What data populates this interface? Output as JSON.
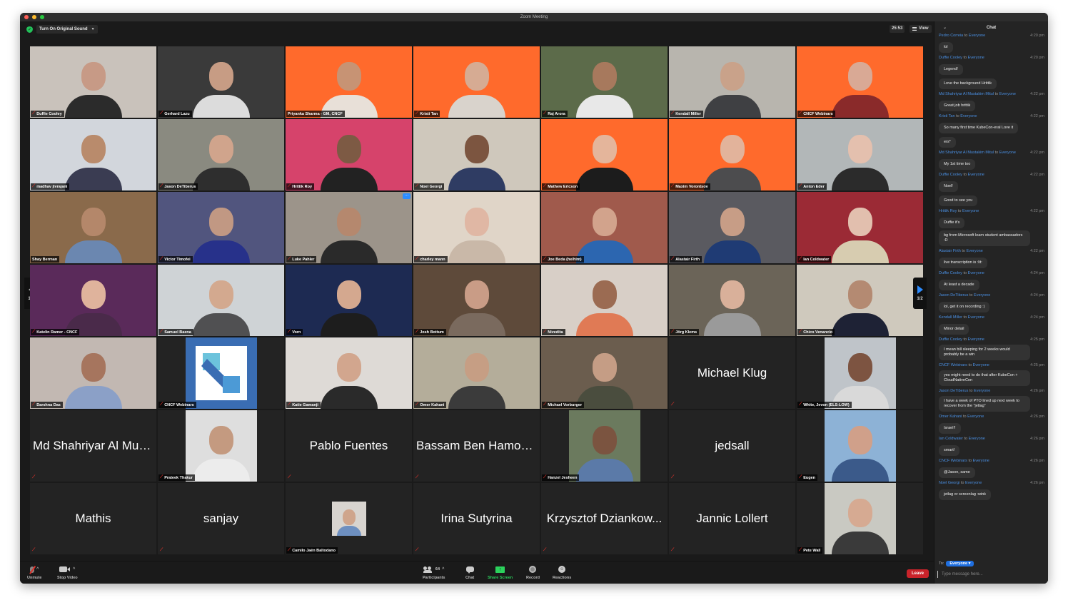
{
  "window": {
    "title": "Zoom Meeting"
  },
  "topbar": {
    "original_sound_label": "Turn On Original Sound",
    "timer": "25:53",
    "view_label": "View"
  },
  "pager": {
    "label": "1/2"
  },
  "tiles": [
    {
      "name": "Duffie Cooley",
      "type": "video",
      "bg": "#c9c2bb",
      "skin": "#c79a86",
      "shirt": "#2b2b2b",
      "muted": true
    },
    {
      "name": "Gerhard Lazu",
      "type": "video",
      "bg": "#3a3a3a",
      "skin": "#c79c84",
      "shirt": "#dcdcdc",
      "muted": true
    },
    {
      "name": "Priyanka Sharma - GM, CNCF",
      "type": "video",
      "bg": "#ff6a2c",
      "skin": "#c79374",
      "shirt": "#e8e0d8",
      "muted": false
    },
    {
      "name": "Kristi Tan",
      "type": "video",
      "bg": "#ff6a2c",
      "skin": "#d6ab93",
      "shirt": "#d9d3cc",
      "muted": true
    },
    {
      "name": "Raj Arora",
      "type": "video",
      "bg": "#5c6b4a",
      "skin": "#a7795d",
      "shirt": "#e8e8e8",
      "muted": true
    },
    {
      "name": "Kendall Miller",
      "type": "video",
      "bg": "#b8b5ae",
      "skin": "#c9a28a",
      "shirt": "#3f4043",
      "muted": true
    },
    {
      "name": "CNCF Webinars",
      "type": "video",
      "bg": "#ff6a2c",
      "skin": "#d9a995",
      "shirt": "#8a2a2a",
      "muted": true
    },
    {
      "name": "madhav jivrajani",
      "type": "video",
      "bg": "#d2d6dc",
      "skin": "#b98b6c",
      "shirt": "#3a3c52",
      "muted": true
    },
    {
      "name": "Jason DeTiberus",
      "type": "video",
      "bg": "#8a8a80",
      "skin": "#d0a48c",
      "shirt": "#2e2e2e",
      "muted": true
    },
    {
      "name": "Hrittik Roy",
      "type": "video",
      "bg": "#d6436b",
      "skin": "#7d5a44",
      "shirt": "#222222",
      "muted": true
    },
    {
      "name": "Noel Georgi",
      "type": "video",
      "bg": "#cfc8bc",
      "skin": "#7c5540",
      "shirt": "#2f3c63",
      "muted": true
    },
    {
      "name": "Mathew Ericson",
      "type": "video",
      "bg": "#ff6a2c",
      "skin": "#e4b59b",
      "shirt": "#1c1c1c",
      "muted": true
    },
    {
      "name": "Maxim Vorontsov",
      "type": "video",
      "bg": "#ff6a2c",
      "skin": "#e2b39b",
      "shirt": "#4c4c4e",
      "muted": true
    },
    {
      "name": "Anton Eder",
      "type": "video",
      "bg": "#b2b7b8",
      "skin": "#e4c0ae",
      "shirt": "#2b2b2b",
      "muted": true
    },
    {
      "name": "Shay Berman",
      "type": "video",
      "bg": "#8a6a4b",
      "skin": "#b4876a",
      "shirt": "#6b87b0",
      "muted": false,
      "active": true
    },
    {
      "name": "Victor Timofei",
      "type": "video",
      "bg": "#51557e",
      "skin": "#c19883",
      "shirt": "#27318a",
      "muted": true
    },
    {
      "name": "Luke Pahler",
      "type": "video",
      "bg": "#9c948a",
      "skin": "#b5886e",
      "shirt": "#2a2a2a",
      "muted": true,
      "more": true
    },
    {
      "name": "charley mann",
      "type": "video",
      "bg": "#e0d5c8",
      "skin": "#e0b7a4",
      "shirt": "#c9b8a8",
      "muted": true
    },
    {
      "name": "Joe Beda (he/him)",
      "type": "video",
      "bg": "#a05a4c",
      "skin": "#d2a38c",
      "shirt": "#2c66b0",
      "muted": true
    },
    {
      "name": "Alastair Firth",
      "type": "video",
      "bg": "#5a5a60",
      "skin": "#c79d86",
      "shirt": "#1f3b74",
      "muted": true
    },
    {
      "name": "Ian Coldwater",
      "type": "video",
      "bg": "#9b2a35",
      "skin": "#e2bfae",
      "shirt": "#d7ccb0",
      "muted": true
    },
    {
      "name": "Katelin Ramer - CNCF",
      "type": "video",
      "bg": "#5a2a5a",
      "skin": "#dfb39c",
      "shirt": "#4a2a4a",
      "muted": true
    },
    {
      "name": "Samuel Baena",
      "type": "video",
      "bg": "#cfd3d6",
      "skin": "#d3a98f",
      "shirt": "#505052",
      "muted": true
    },
    {
      "name": "Vorn",
      "type": "video",
      "bg": "#1d2a52",
      "skin": "#d4a88f",
      "shirt": "#1d1d1d",
      "muted": true
    },
    {
      "name": "Josh Bottum",
      "type": "video",
      "bg": "#5e4a3a",
      "skin": "#c99c86",
      "shirt": "#7a6a5e",
      "muted": true
    },
    {
      "name": "Nivedita",
      "type": "video",
      "bg": "#d8cfc7",
      "skin": "#9b6b52",
      "shirt": "#e07a55",
      "muted": true
    },
    {
      "name": "Jörg Klems",
      "type": "video",
      "bg": "#6b6458",
      "skin": "#d9b09a",
      "shirt": "#9a9a9a",
      "muted": true
    },
    {
      "name": "Chico Venancio",
      "type": "video",
      "bg": "#cfc9bd",
      "skin": "#b48a72",
      "shirt": "#1e2235",
      "muted": true
    },
    {
      "name": "Darshna Das",
      "type": "video",
      "bg": "#c2b8b2",
      "skin": "#a6755e",
      "shirt": "#8ba0c7",
      "muted": true
    },
    {
      "name": "CNCF Webinars",
      "type": "logo",
      "muted": true
    },
    {
      "name": "Katie Gamanji",
      "type": "video",
      "bg": "#dedad6",
      "skin": "#d2a68e",
      "shirt": "#2a2a2a",
      "muted": true
    },
    {
      "name": "Omer Kahani",
      "type": "video",
      "bg": "#b4ad9a",
      "skin": "#c69e84",
      "shirt": "#3b3b3b",
      "muted": true
    },
    {
      "name": "Michael Vorburger",
      "type": "video",
      "bg": "#6b5d4e",
      "skin": "#c59d85",
      "shirt": "#4a4d3e",
      "muted": true
    },
    {
      "name": "Michael Klug",
      "type": "name",
      "muted": true
    },
    {
      "name": "White, Jevon (ELS-LOW)",
      "type": "portrait",
      "bg": "#bfc4c9",
      "skin": "#7d5441",
      "shirt": "#d9d9d9",
      "muted": true
    },
    {
      "name": "Md Shahriyar Al Mus...",
      "type": "name",
      "muted": true
    },
    {
      "name": "Prateek Thakur",
      "type": "portrait",
      "bg": "#dedede",
      "skin": "#c49a80",
      "shirt": "#ececec",
      "muted": true
    },
    {
      "name": "Pablo Fuentes",
      "type": "name",
      "muted": true
    },
    {
      "name": "Bassam Ben Hamou...",
      "type": "name",
      "muted": true
    },
    {
      "name": "Hanzel Jesheen",
      "type": "portrait",
      "bg": "#6b7a5e",
      "skin": "#7b5440",
      "shirt": "#5b7aa8",
      "muted": true
    },
    {
      "name": "jedsall",
      "type": "name",
      "muted": true
    },
    {
      "name": "Eugen",
      "type": "portrait",
      "bg": "#8db2d6",
      "skin": "#d0a08a",
      "shirt": "#3b5a8a",
      "muted": true
    },
    {
      "name": "Mathis",
      "type": "name",
      "muted": true
    },
    {
      "name": "sanjay",
      "type": "name",
      "muted": true
    },
    {
      "name": "Camilo Jaén Baltodano",
      "type": "small",
      "bg": "#d8d4cf",
      "skin": "#cfa58c",
      "shirt": "#6d8fc0",
      "muted": true
    },
    {
      "name": "Irina Sutyrina",
      "type": "name",
      "muted": true
    },
    {
      "name": "Krzysztof Dziankow...",
      "type": "name",
      "muted": true
    },
    {
      "name": "Jannic Lollert",
      "type": "name",
      "muted": true
    },
    {
      "name": "Pete Wall",
      "type": "portrait",
      "bg": "#c9c9c2",
      "skin": "#d6aa92",
      "shirt": "#3a3a3a",
      "muted": true
    }
  ],
  "toolbar": {
    "unmute": "Unmute",
    "stop_video": "Stop Video",
    "participants": "Participants",
    "participant_count": "64",
    "chat": "Chat",
    "share_screen": "Share Screen",
    "record": "Record",
    "reactions": "Reactions",
    "leave": "Leave"
  },
  "chat": {
    "title": "Chat",
    "to_label": "To:",
    "to_value": "Everyone",
    "placeholder": "Type message here...",
    "to_word": "to",
    "messages": [
      {
        "from": "Pedro Correia",
        "to": "Everyone",
        "time": "4:20 pm",
        "texts": [
          "lol"
        ]
      },
      {
        "from": "Duffie Cooley",
        "to": "Everyone",
        "time": "4:20 pm",
        "texts": [
          "Legend!",
          "Love the background Hrittik"
        ]
      },
      {
        "from": "Md Shahriyar Al Mustakim Mitul",
        "to": "Everyone",
        "time": "4:22 pm",
        "texts": [
          "Great job hrittik"
        ]
      },
      {
        "from": "Kristi Tan",
        "to": "Everyone",
        "time": "4:22 pm",
        "texts": [
          "So many first time KubeCon-eral Love it",
          "ers*"
        ]
      },
      {
        "from": "Md Shahriyar Al Mustakim Mitul",
        "to": "Everyone",
        "time": "4:22 pm",
        "texts": [
          "My 1st time too"
        ]
      },
      {
        "from": "Duffie Cooley",
        "to": "Everyone",
        "time": "4:22 pm",
        "texts": [
          "Noel!",
          "Good to see you"
        ]
      },
      {
        "from": "Hrittik Roy",
        "to": "Everyone",
        "time": "4:22 pm",
        "texts": [
          "Duffie it's",
          "bg from Microsoft learn student ambassadors :D"
        ]
      },
      {
        "from": "Alastair Firth",
        "to": "Everyone",
        "time": "4:22 pm",
        "texts": [
          "live transcription is :lit:"
        ]
      },
      {
        "from": "Duffie Cooley",
        "to": "Everyone",
        "time": "4:24 pm",
        "texts": [
          "At least a decade"
        ]
      },
      {
        "from": "Jason DeTiberus",
        "to": "Everyone",
        "time": "4:24 pm",
        "texts": [
          "lol, get it on recording :)"
        ]
      },
      {
        "from": "Kendall Miller",
        "to": "Everyone",
        "time": "4:24 pm",
        "texts": [
          "Minor detail"
        ]
      },
      {
        "from": "Duffie Cooley",
        "to": "Everyone",
        "time": "4:25 pm",
        "texts": [
          "I mean bill sleeping for 2 weeks would probably be a win"
        ]
      },
      {
        "from": "CNCF Webinars",
        "to": "Everyone",
        "time": "4:25 pm",
        "texts": [
          "yes might need to do that after KubeCon + CloudNativeCon"
        ]
      },
      {
        "from": "Jason DeTiberus",
        "to": "Everyone",
        "time": "4:26 pm",
        "texts": [
          "I have a week of PTO lined up next week to recover from the \"jetlag\""
        ]
      },
      {
        "from": "Omer Kahani",
        "to": "Everyone",
        "time": "4:26 pm",
        "texts": [
          "Israel!!"
        ]
      },
      {
        "from": "Ian Coldwater",
        "to": "Everyone",
        "time": "4:26 pm",
        "texts": [
          "smart!"
        ]
      },
      {
        "from": "CNCF Webinars",
        "to": "Everyone",
        "time": "4:26 pm",
        "texts": [
          "@Jason, same"
        ]
      },
      {
        "from": "Noel Georgi",
        "to": "Everyone",
        "time": "4:26 pm",
        "texts": [
          "jetlag or screenlag :wink"
        ]
      }
    ]
  },
  "colors": {
    "accent": "#2d8cff",
    "share_green": "#2bd25c",
    "leave_red": "#c9232a",
    "mute_red": "#e0322b",
    "active_speaker": "#e9f27a",
    "chat_name_blue": "#4a8fe2"
  }
}
